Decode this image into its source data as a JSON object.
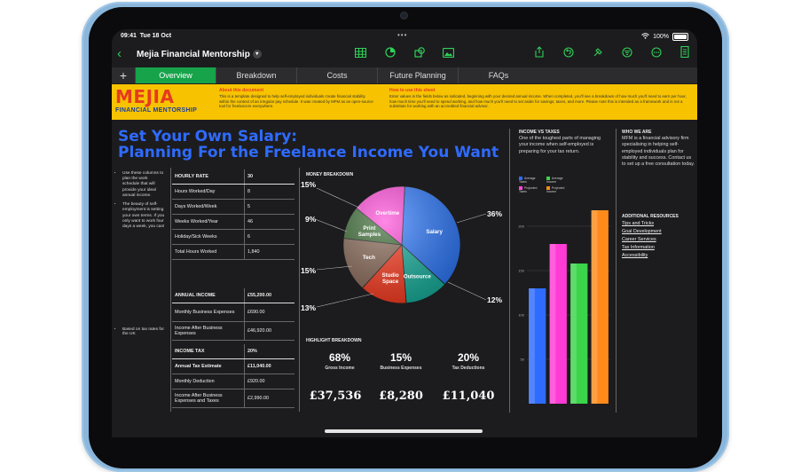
{
  "status": {
    "time": "09:41",
    "date": "Tue 18 Oct",
    "battery": "100%"
  },
  "document": {
    "title": "Mejia Financial Mentorship"
  },
  "toolbar_icons": [
    "table-icon",
    "chart-icon",
    "shapes-icon",
    "media-icon",
    "share-icon",
    "undo-icon",
    "format-brush-icon",
    "filter-icon",
    "more-icon",
    "document-icon"
  ],
  "tabs": [
    {
      "label": "Overview",
      "active": true
    },
    {
      "label": "Breakdown"
    },
    {
      "label": "Costs"
    },
    {
      "label": "Future Planning"
    },
    {
      "label": "FAQs"
    }
  ],
  "banner": {
    "logo_big": "MEJIA",
    "logo_small": "FINANCIAL MENTORSHIP",
    "about_title": "About this document",
    "about_text": "This is a template designed to help self-employed individuals create financial stability within the context of an irregular pay schedule. It was created by MFM as an open-source tool for freelancers everywhere.",
    "howto_title": "How to use this sheet",
    "howto_text": "Enter values in the fields below as indicated, beginning with your desired annual income. When completed, you'll see a breakdown of how much you'll need to earn per hour, how much time you'll need to spend working, and how much you'll need to set aside for savings, taxes, and more. Please note this is intended as a framework and is not a substitute for working with an accredited financial advisor."
  },
  "headline": {
    "line1": "Set Your Own Salary:",
    "line2": "Planning For the Freelance Income You Want"
  },
  "notes": {
    "a": "Use these columns to plan the work schedule that will provide your ideal annual income.",
    "b": "The beauty of self-employment is setting your own terms. If you only want to work four days a week, you can!",
    "c": "Based on tax rates for the UK"
  },
  "hours_table": {
    "header": {
      "label": "HOURLY RATE",
      "value": "30"
    },
    "rows": [
      {
        "label": "Hours Worked/Day",
        "value": "8"
      },
      {
        "label": "Days Worked/Week",
        "value": "5"
      },
      {
        "label": "Weeks Worked/Year",
        "value": "46"
      },
      {
        "label": "Holiday/Sick Weeks",
        "value": "6"
      },
      {
        "label": "Total Hours Worked",
        "value": "1,840"
      }
    ]
  },
  "income_table": {
    "header": {
      "label": "ANNUAL INCOME",
      "value": "£55,200.00"
    },
    "rows": [
      {
        "label": "Monthly Business Expenses",
        "value": "£690.00"
      },
      {
        "label": "Income After Business Expenses",
        "value": "£46,920.00"
      }
    ]
  },
  "tax_table": {
    "header": {
      "label": "INCOME TAX",
      "value": "20%"
    },
    "rows": [
      {
        "label": "Annual Tax Estimate",
        "value": "£11,040.00",
        "bold": true
      },
      {
        "label": "Monthly Deduction",
        "value": "£920.00"
      },
      {
        "label": "Income After Business Expenses and Taxes",
        "value": "£2,990.00"
      }
    ]
  },
  "money_breakdown": {
    "title": "MONEY BREAKDOWN",
    "slices": [
      {
        "name": "Salary",
        "value": 36,
        "color": "#2f7bff"
      },
      {
        "name": "Outsource",
        "value": 12,
        "color": "#18b3a0"
      },
      {
        "name": "Studio Space",
        "value": 13,
        "color": "#ff3b1f"
      },
      {
        "name": "Tech",
        "value": 15,
        "color": "#8a6a58"
      },
      {
        "name": "Print Samples",
        "value": 9,
        "color": "#3a6b33"
      },
      {
        "name": "Overtime",
        "value": 15,
        "color": "#ff48d8"
      }
    ],
    "labels": {
      "top_left": "15%",
      "left_upper": "9%",
      "left_mid": "15%",
      "left_low": "13%",
      "right_upper": "36%",
      "right_low": "12%"
    }
  },
  "highlight": {
    "title": "HIGHLIGHT BREAKDOWN",
    "items": [
      {
        "pct": "68%",
        "label": "Gross Income",
        "amount": "£37,536"
      },
      {
        "pct": "15%",
        "label": "Business Expenses",
        "amount": "£8,280"
      },
      {
        "pct": "20%",
        "label": "Tax Deductions",
        "amount": "£11,040"
      }
    ]
  },
  "income_vs_taxes": {
    "title": "INCOME VS TAXES",
    "text": "One of the toughest parts of managing your income when self-employed is preparing for your tax return.",
    "legend": [
      {
        "name": "Average Taxes",
        "color": "#2f6bff"
      },
      {
        "name": "Average Income",
        "color": "#3bd44a"
      },
      {
        "name": "Projected Taxes",
        "color": "#ff48d8"
      },
      {
        "name": "Projected Income",
        "color": "#ff8a1a"
      }
    ]
  },
  "chart_data": {
    "type": "bar",
    "categories": [
      "Average Taxes",
      "Projected Taxes",
      "Average Income",
      "Projected Income"
    ],
    "values": [
      130,
      180,
      158,
      218
    ],
    "colors": [
      "#2f6bff",
      "#ff3bd6",
      "#3bd44a",
      "#ff8a1a"
    ],
    "ylim": [
      0,
      220
    ],
    "ticks": [
      "200",
      "150",
      "100",
      "50"
    ]
  },
  "who": {
    "title": "WHO WE ARE",
    "text": "MFM is a financial advisory firm specialising in helping self-employed individuals plan for stability and success. Contact us to set up a free consultation today."
  },
  "resources": {
    "title": "ADDITIONAL RESOURCES",
    "links": [
      "Tips and Tricks",
      "Goal Development",
      "Career Services",
      "Tax Information",
      "Accessibility"
    ]
  }
}
